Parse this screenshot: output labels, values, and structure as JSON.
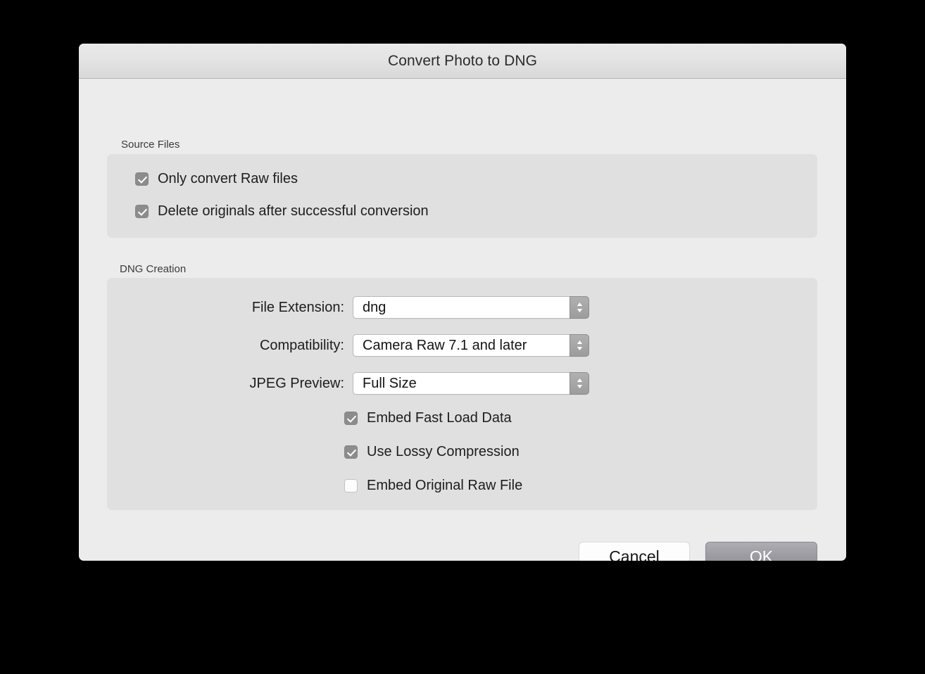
{
  "window": {
    "title": "Convert Photo to DNG"
  },
  "sections": {
    "source_files": {
      "label": "Source Files",
      "checkboxes": [
        {
          "label": "Only convert Raw files",
          "checked": true
        },
        {
          "label": "Delete originals after successful conversion",
          "checked": true
        }
      ]
    },
    "dng_creation": {
      "label": "DNG Creation",
      "fields": [
        {
          "label": "File Extension:",
          "value": "dng"
        },
        {
          "label": "Compatibility:",
          "value": "Camera Raw 7.1 and later"
        },
        {
          "label": "JPEG Preview:",
          "value": "Full Size"
        }
      ],
      "checkboxes": [
        {
          "label": "Embed Fast Load Data",
          "checked": true
        },
        {
          "label": "Use Lossy Compression",
          "checked": true
        },
        {
          "label": "Embed Original Raw File",
          "checked": false
        }
      ]
    }
  },
  "footer": {
    "cancel_label": "Cancel",
    "ok_label": "OK"
  },
  "icons": {
    "popup_arrows": "chevron-up-down-icon",
    "checkmark": "checkmark-icon"
  },
  "colors": {
    "desktop_background": "#000000",
    "dialog_background": "#ececec",
    "groupbox_background": "#e0e0e0",
    "titlebar_top": "#eaeaea",
    "titlebar_bottom": "#d8d8d8",
    "checkbox_checked": "#8c8c8c",
    "default_button_top": "#adadb2",
    "default_button_bottom": "#8d8d93",
    "text_primary": "#1d1d1d"
  }
}
